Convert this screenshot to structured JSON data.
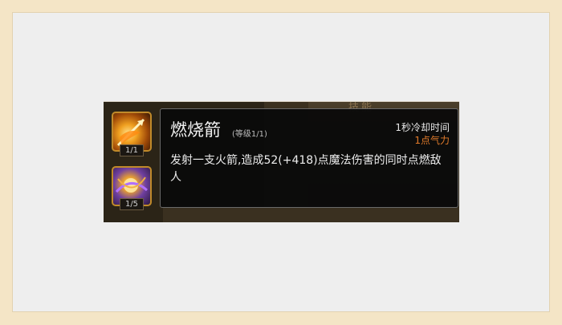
{
  "background_header": "技能",
  "slots": [
    {
      "icon": "flaming-arrow-icon",
      "level": "1/1"
    },
    {
      "icon": "arcane-burst-icon",
      "level": "1/5"
    }
  ],
  "tooltip": {
    "name": "燃烧箭",
    "level": "(等级1/1)",
    "cooldown": "1秒冷却时间",
    "cost": "1点气力",
    "description": "发射一支火箭,造成52(+418)点魔法伤害的同时点燃敌人"
  },
  "colors": {
    "cost": "#e07a2a",
    "slot_border": "#c08a2a",
    "tooltip_bg": "#0a0a0a"
  }
}
